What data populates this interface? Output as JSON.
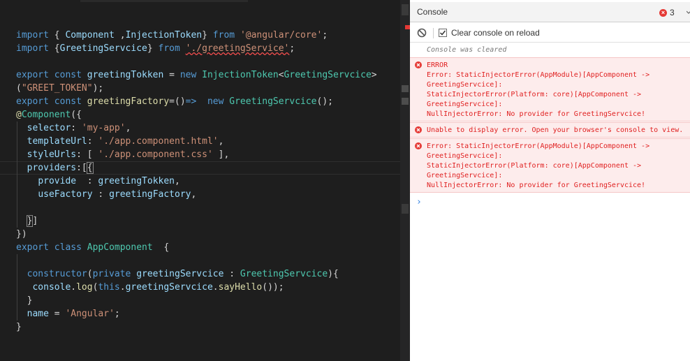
{
  "editor": {
    "lines": [
      [
        [
          "kw",
          "import"
        ],
        [
          "plain",
          " { "
        ],
        [
          "var",
          "Component"
        ],
        [
          "plain",
          " ,"
        ],
        [
          "var",
          "InjectionToken"
        ],
        [
          "plain",
          "} "
        ],
        [
          "kw",
          "from"
        ],
        [
          "plain",
          " "
        ],
        [
          "str",
          "'@angular/core'"
        ],
        [
          "plain",
          ";"
        ]
      ],
      [
        [
          "kw",
          "import"
        ],
        [
          "plain",
          " {"
        ],
        [
          "var",
          "GreetingServcice"
        ],
        [
          "plain",
          "} "
        ],
        [
          "kw",
          "from"
        ],
        [
          "plain",
          " "
        ],
        [
          "strsq",
          "'./greetingService'"
        ],
        [
          "plain",
          ";"
        ]
      ],
      [],
      [
        [
          "kw",
          "export"
        ],
        [
          "plain",
          " "
        ],
        [
          "kw",
          "const"
        ],
        [
          "plain",
          " "
        ],
        [
          "var",
          "greetingTokken"
        ],
        [
          "plain",
          " = "
        ],
        [
          "kw",
          "new"
        ],
        [
          "plain",
          " "
        ],
        [
          "type",
          "InjectionToken"
        ],
        [
          "plain",
          "<"
        ],
        [
          "type",
          "GreetingServcice"
        ],
        [
          "plain",
          ">"
        ]
      ],
      [
        [
          "plain",
          "("
        ],
        [
          "str",
          "\"GREET_TOKEN\""
        ],
        [
          "plain",
          ");"
        ]
      ],
      [
        [
          "kw",
          "export"
        ],
        [
          "plain",
          " "
        ],
        [
          "kw",
          "const"
        ],
        [
          "plain",
          " "
        ],
        [
          "fn",
          "greetingFactory"
        ],
        [
          "plain",
          "=()"
        ],
        [
          "kw",
          "=>"
        ],
        [
          "plain",
          "  "
        ],
        [
          "kw",
          "new"
        ],
        [
          "plain",
          " "
        ],
        [
          "type",
          "GreetingServcice"
        ],
        [
          "plain",
          "();"
        ]
      ],
      [
        [
          "fn",
          "@"
        ],
        [
          "type",
          "Component"
        ],
        [
          "plain",
          "({"
        ]
      ],
      [
        [
          "plain",
          "  "
        ],
        [
          "var",
          "selector"
        ],
        [
          "plain",
          ": "
        ],
        [
          "str",
          "'my-app'"
        ],
        [
          "plain",
          ","
        ]
      ],
      [
        [
          "plain",
          "  "
        ],
        [
          "var",
          "templateUrl"
        ],
        [
          "plain",
          ": "
        ],
        [
          "str",
          "'./app.component.html'"
        ],
        [
          "plain",
          ","
        ]
      ],
      [
        [
          "plain",
          "  "
        ],
        [
          "var",
          "styleUrls"
        ],
        [
          "plain",
          ": [ "
        ],
        [
          "str",
          "'./app.component.css'"
        ],
        [
          "plain",
          " ],"
        ]
      ],
      [
        [
          "plain",
          "  "
        ],
        [
          "var",
          "providers"
        ],
        [
          "plain",
          ":["
        ],
        [
          "hl",
          "{"
        ]
      ],
      [
        [
          "plain",
          "    "
        ],
        [
          "var",
          "provide"
        ],
        [
          "plain",
          "  : "
        ],
        [
          "var",
          "greetingTokken"
        ],
        [
          "plain",
          ","
        ]
      ],
      [
        [
          "plain",
          "    "
        ],
        [
          "var",
          "useFactory"
        ],
        [
          "plain",
          " : "
        ],
        [
          "var",
          "greetingFactory"
        ],
        [
          "plain",
          ","
        ]
      ],
      [],
      [
        [
          "plain",
          "  "
        ],
        [
          "hl",
          "}"
        ],
        [
          "plain",
          "]"
        ]
      ],
      [
        [
          "plain",
          "})"
        ]
      ],
      [
        [
          "kw",
          "export"
        ],
        [
          "plain",
          " "
        ],
        [
          "kw",
          "class"
        ],
        [
          "plain",
          " "
        ],
        [
          "type",
          "AppComponent"
        ],
        [
          "plain",
          "  {"
        ]
      ],
      [],
      [
        [
          "plain",
          "  "
        ],
        [
          "kw",
          "constructor"
        ],
        [
          "plain",
          "("
        ],
        [
          "kw",
          "private"
        ],
        [
          "plain",
          " "
        ],
        [
          "var",
          "greetingServcice"
        ],
        [
          "plain",
          " : "
        ],
        [
          "type",
          "GreetingServcice"
        ],
        [
          "plain",
          "){"
        ]
      ],
      [
        [
          "plain",
          "   "
        ],
        [
          "var",
          "console"
        ],
        [
          "plain",
          "."
        ],
        [
          "fn",
          "log"
        ],
        [
          "plain",
          "("
        ],
        [
          "kw",
          "this"
        ],
        [
          "plain",
          "."
        ],
        [
          "var",
          "greetingServcice"
        ],
        [
          "plain",
          "."
        ],
        [
          "fn",
          "sayHello"
        ],
        [
          "plain",
          "());"
        ]
      ],
      [
        [
          "plain",
          "  }"
        ]
      ],
      [
        [
          "plain",
          "  "
        ],
        [
          "var",
          "name"
        ],
        [
          "plain",
          " = "
        ],
        [
          "str",
          "'Angular'"
        ],
        [
          "plain",
          ";"
        ]
      ],
      [
        [
          "plain",
          "}"
        ]
      ]
    ]
  },
  "console": {
    "tab_label": "Console",
    "error_count": "3",
    "clear_label": "Clear console on reload",
    "cleared_message": "Console was cleared",
    "errors": [
      "ERROR\nError: StaticInjectorError(AppModule)[AppComponent ->\nGreetingServcice]:\nStaticInjectorError(Platform: core)[AppComponent ->\nGreetingServcice]:\nNullInjectorError: No provider for GreetingServcice!",
      "Unable to display error. Open your browser's console to view.",
      "Error: StaticInjectorError(AppModule)[AppComponent ->\nGreetingServcice]:\nStaticInjectorError(Platform: core)[AppComponent ->\nGreetingServcice]:\nNullInjectorError: No provider for GreetingServcice!"
    ],
    "prompt_symbol": "›"
  },
  "colors": {
    "editor_bg": "#1e1e1e",
    "keyword": "#569cd6",
    "string": "#ce9178",
    "variable": "#9cdcfe",
    "type": "#4ec9b0",
    "function": "#dcdcaa",
    "error_text": "#e02020",
    "error_bg": "#fdecec",
    "error_icon": "#e53935"
  }
}
